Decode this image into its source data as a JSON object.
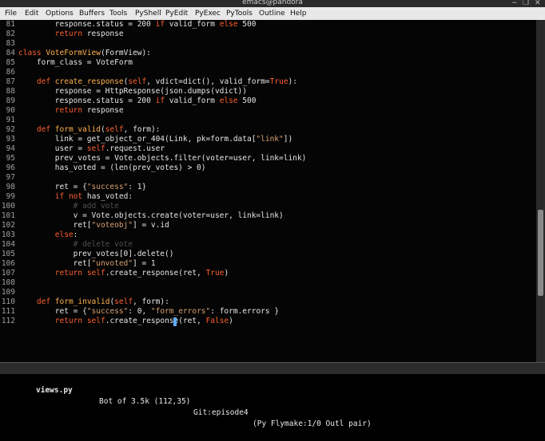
{
  "window": {
    "title": "emacs@pandora",
    "controls": [
      "−",
      "❐",
      "✕"
    ]
  },
  "menubar": [
    "File",
    "Edit",
    "Options",
    "Buffers",
    "Tools",
    "PyShell",
    "PyEdit",
    "PyExec",
    "PyTools",
    "Outline",
    "Help"
  ],
  "lines": [
    {
      "n": "81",
      "t": [
        [
          "        response.status = 200 ",
          ""
        ],
        [
          "if",
          "kw"
        ],
        [
          " valid_form ",
          ""
        ],
        [
          "else",
          "kw"
        ],
        [
          " 500",
          ""
        ]
      ]
    },
    {
      "n": "82",
      "t": [
        [
          "        ",
          ""
        ],
        [
          "return",
          "kw"
        ],
        [
          " response",
          ""
        ]
      ]
    },
    {
      "n": "83",
      "t": []
    },
    {
      "n": "84",
      "t": [
        [
          "class",
          "kw"
        ],
        [
          " ",
          ""
        ],
        [
          "VoteFormView",
          "cls"
        ],
        [
          "(FormView):",
          ""
        ]
      ]
    },
    {
      "n": "85",
      "t": [
        [
          "    form_class = VoteForm",
          ""
        ]
      ]
    },
    {
      "n": "86",
      "t": []
    },
    {
      "n": "87",
      "t": [
        [
          "    ",
          ""
        ],
        [
          "def",
          "kw"
        ],
        [
          " ",
          ""
        ],
        [
          "create_response",
          "fn"
        ],
        [
          "(",
          ""
        ],
        [
          "self",
          "kw"
        ],
        [
          ", vdict=dict(), valid_form=",
          ""
        ],
        [
          "True",
          "kw"
        ],
        [
          "):",
          ""
        ]
      ]
    },
    {
      "n": "88",
      "t": [
        [
          "        response = HttpResponse(json.dumps(vdict))",
          ""
        ]
      ]
    },
    {
      "n": "89",
      "t": [
        [
          "        response.status = 200 ",
          ""
        ],
        [
          "if",
          "kw"
        ],
        [
          " valid_form ",
          ""
        ],
        [
          "else",
          "kw"
        ],
        [
          " 500",
          ""
        ]
      ]
    },
    {
      "n": "90",
      "t": [
        [
          "        ",
          ""
        ],
        [
          "return",
          "kw"
        ],
        [
          " response",
          ""
        ]
      ]
    },
    {
      "n": "91",
      "t": []
    },
    {
      "n": "92",
      "t": [
        [
          "    ",
          ""
        ],
        [
          "def",
          "kw"
        ],
        [
          " ",
          ""
        ],
        [
          "form_valid",
          "fn"
        ],
        [
          "(",
          ""
        ],
        [
          "self",
          "kw"
        ],
        [
          ", form):",
          ""
        ]
      ]
    },
    {
      "n": "93",
      "t": [
        [
          "        link = get_object_or_404(Link, pk=form.data[",
          ""
        ],
        [
          "\"link\"",
          "str"
        ],
        [
          "])",
          ""
        ]
      ]
    },
    {
      "n": "94",
      "t": [
        [
          "        user = ",
          ""
        ],
        [
          "self",
          "kw"
        ],
        [
          ".request.user",
          ""
        ]
      ]
    },
    {
      "n": "95",
      "t": [
        [
          "        prev_votes = Vote.objects.filter(voter=user, link=link)",
          ""
        ]
      ]
    },
    {
      "n": "96",
      "t": [
        [
          "        has_voted = (len(prev_votes) > 0)",
          ""
        ]
      ]
    },
    {
      "n": "97",
      "t": []
    },
    {
      "n": "98",
      "t": [
        [
          "        ret = {",
          ""
        ],
        [
          "\"success\"",
          "str"
        ],
        [
          ": 1}",
          ""
        ]
      ]
    },
    {
      "n": "99",
      "t": [
        [
          "        ",
          ""
        ],
        [
          "if",
          "kw"
        ],
        [
          " ",
          ""
        ],
        [
          "not",
          "kw"
        ],
        [
          " has_voted:",
          ""
        ]
      ]
    },
    {
      "n": "100",
      "t": [
        [
          "            ",
          ""
        ],
        [
          "# add vote",
          "cmt"
        ]
      ]
    },
    {
      "n": "101",
      "t": [
        [
          "            v = Vote.objects.create(voter=user, link=link)",
          ""
        ]
      ]
    },
    {
      "n": "102",
      "t": [
        [
          "            ret[",
          ""
        ],
        [
          "\"voteobj\"",
          "str"
        ],
        [
          "] = v.id",
          ""
        ]
      ]
    },
    {
      "n": "103",
      "t": [
        [
          "        ",
          ""
        ],
        [
          "else",
          "kw"
        ],
        [
          ":",
          ""
        ]
      ]
    },
    {
      "n": "104",
      "t": [
        [
          "            ",
          ""
        ],
        [
          "# delete vote",
          "cmt"
        ]
      ]
    },
    {
      "n": "105",
      "t": [
        [
          "            prev_votes[0].delete()",
          ""
        ]
      ]
    },
    {
      "n": "106",
      "t": [
        [
          "            ret[",
          ""
        ],
        [
          "\"unvoted\"",
          "str"
        ],
        [
          "] = 1",
          ""
        ]
      ]
    },
    {
      "n": "107",
      "t": [
        [
          "        ",
          ""
        ],
        [
          "return",
          "kw"
        ],
        [
          " ",
          ""
        ],
        [
          "self",
          "kw"
        ],
        [
          ".create_response(ret, ",
          ""
        ],
        [
          "True",
          "kw"
        ],
        [
          ")",
          ""
        ]
      ]
    },
    {
      "n": "108",
      "t": []
    },
    {
      "n": "109",
      "t": []
    },
    {
      "n": "110",
      "t": [
        [
          "    ",
          ""
        ],
        [
          "def",
          "kw"
        ],
        [
          " ",
          ""
        ],
        [
          "form_invalid",
          "fn"
        ],
        [
          "(",
          ""
        ],
        [
          "self",
          "kw"
        ],
        [
          ", form):",
          ""
        ]
      ]
    },
    {
      "n": "111",
      "t": [
        [
          "        ret = {",
          ""
        ],
        [
          "\"success\"",
          "str"
        ],
        [
          ": 0, ",
          ""
        ],
        [
          "\"form_errors\"",
          "str"
        ],
        [
          ": form.errors }",
          ""
        ]
      ]
    },
    {
      "n": "112",
      "t": [
        [
          "        ",
          ""
        ],
        [
          "return",
          "kw"
        ],
        [
          " ",
          ""
        ],
        [
          "self",
          "kw"
        ],
        [
          ".create_response(ret, ",
          ""
        ],
        [
          "False",
          "kw"
        ],
        [
          ")",
          ""
        ]
      ]
    }
  ],
  "modeline": {
    "status": "-:**-",
    "buffer": "views.py",
    "position": "Bot of 3.5k (112,35)",
    "vc": "Git:episode4",
    "modes": "(Py Flymake:1/0 Outl pair)"
  },
  "colors": {
    "keyword": "#ff5f2e",
    "function": "#ffb14e",
    "string": "#d8a070",
    "comment": "#505050",
    "cursor": "#5fa9ff"
  }
}
